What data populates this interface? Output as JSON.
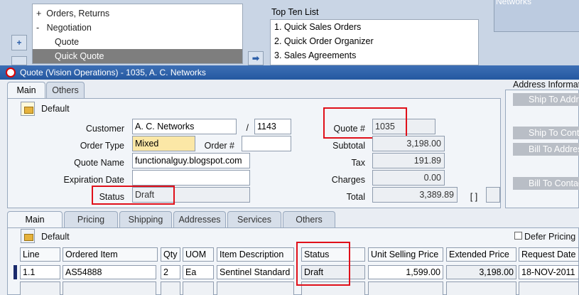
{
  "navigator": {
    "items": [
      {
        "prefix": "+",
        "label": "Orders, Returns"
      },
      {
        "prefix": "-",
        "label": "Negotiation"
      },
      {
        "prefix": "",
        "label": "Quote"
      },
      {
        "prefix": "",
        "label": "Quick Quote"
      }
    ],
    "add_glyph": "+",
    "arrow_glyph": "➡"
  },
  "top_ten": {
    "title": "Top Ten List",
    "items": [
      "1. Quick Sales Orders",
      "2. Quick Order Organizer",
      "3. Sales Agreements"
    ]
  },
  "right_panel_text": "Networks",
  "window_title": "Quote (Vision Operations) - 1035, A. C. Networks",
  "header_tabs": [
    "Main",
    "Others"
  ],
  "header": {
    "folder_label": "Default",
    "customer_label": "Customer",
    "customer_value": "A. C. Networks",
    "slash": "/",
    "customer_number": "1143",
    "order_type_label": "Order Type",
    "order_type_value": "Mixed",
    "order_number_label": "Order #",
    "order_number_value": "",
    "quote_name_label": "Quote Name",
    "quote_name_value": "functionalguy.blogspot.com",
    "expiration_label": "Expiration Date",
    "expiration_value": "",
    "status_label": "Status",
    "status_value": "Draft",
    "quote_number_label": "Quote #",
    "quote_number_value": "1035",
    "subtotal_label": "Subtotal",
    "subtotal_value": "3,198.00",
    "tax_label": "Tax",
    "tax_value": "191.89",
    "charges_label": "Charges",
    "charges_value": "0.00",
    "total_label": "Total",
    "total_value": "3,389.89",
    "bracket_glyph": "[ ]"
  },
  "address_panel": {
    "title": "Address Information",
    "buttons": [
      "Ship To Address",
      "Ship To Contact",
      "Bill To Address",
      "Bill To Contact"
    ]
  },
  "line_tabs": [
    "Main",
    "Pricing",
    "Shipping",
    "Addresses",
    "Services",
    "Others"
  ],
  "lines": {
    "folder_label": "Default",
    "defer_pricing_label": "Defer Pricing",
    "columns": [
      "Line",
      "Ordered Item",
      "Qty",
      "UOM",
      "Item Description",
      "Status",
      "Unit Selling Price",
      "Extended Price",
      "Request Date"
    ],
    "rows": [
      [
        "1.1",
        "AS54888",
        "2",
        "Ea",
        "Sentinel Standard",
        "Draft",
        "1,599.00",
        "3,198.00",
        "18-NOV-2011"
      ]
    ]
  },
  "colors": {
    "highlight": "#e0101a",
    "titlebar": "#2458a0",
    "required_field": "#fbe7a6"
  }
}
